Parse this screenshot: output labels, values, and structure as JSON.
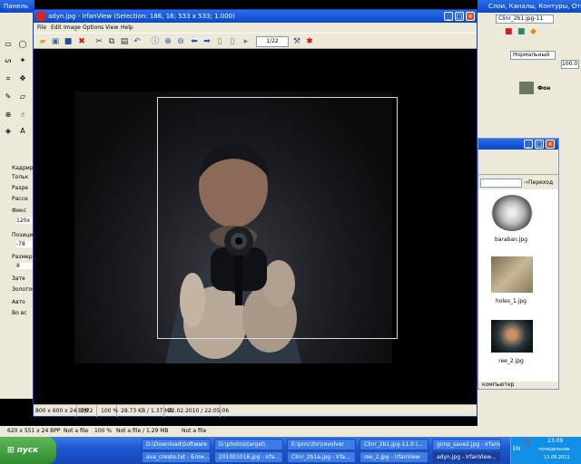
{
  "colors": {
    "xp_blue": "#0a48c8",
    "xp_face": "#ece9d8",
    "close_red": "#d3502c",
    "start_green": "#2e8b2e"
  },
  "gimp_toolbox": {
    "title": "Панель",
    "labels": [
      "Кадрир",
      "Тольк",
      "Разре",
      "Расси",
      "Фикс",
      "120x",
      "Позиция",
      "-78",
      "Размер",
      "8",
      "Зате",
      "Золотое",
      "Авто",
      "Во вс"
    ]
  },
  "gimp_layers": {
    "title": "Слои, Каналы, Контуры, Отмени...",
    "doc": "Clinr_2b1.jpg-11",
    "mode": "Нормальный",
    "opacity": "100.0",
    "layer_name": "Фон"
  },
  "browser": {
    "go": "Переход",
    "thumbs": [
      "baraban.jpg",
      "holes_1.jpg",
      "ree_2.jpg"
    ],
    "footer": "компьютер"
  },
  "background_status": {
    "left": "620 x 551 x 24 BPP",
    "mid1": "Not a file",
    "mid2": "100 %",
    "mid3": "Not a file / 1.29 MB",
    "mid4": "Not a file"
  },
  "irfanview": {
    "title": "adyn.jpg - IrfanView (Selection: 186, 16; 533 x 533; 1.000)",
    "menus": [
      "File",
      "Edit",
      "Image",
      "Options",
      "View",
      "Help"
    ],
    "page_indicator": "1/22",
    "status": {
      "dims": "800 x 600 x 24 BPP",
      "index": "1/22",
      "zoom": "100 %",
      "size": "28.73 KB / 1.37 MB",
      "date": "22.02.2010 / 22:05:06"
    }
  },
  "taskbar": {
    "start": "пуск",
    "tasks": [
      "D:\\Download\\Software",
      "D:\\photos\\target\\",
      "E:\\proc\\for\\revolver",
      "Clinr_2b1.jpg-11.0 (...",
      "gimp_save2.jpg - IrfanV...",
      "ava_create.txt - Блок...",
      "201001016.jpg - Irfa...",
      "Clinr_2b1a.jpg - Irfa...",
      "ree_2.jpg - IrfanView",
      "adyn.jpg - IrfanView..."
    ],
    "lang": "EN",
    "time": "23:09",
    "day": "понедельник",
    "date": "12.09.2011"
  }
}
